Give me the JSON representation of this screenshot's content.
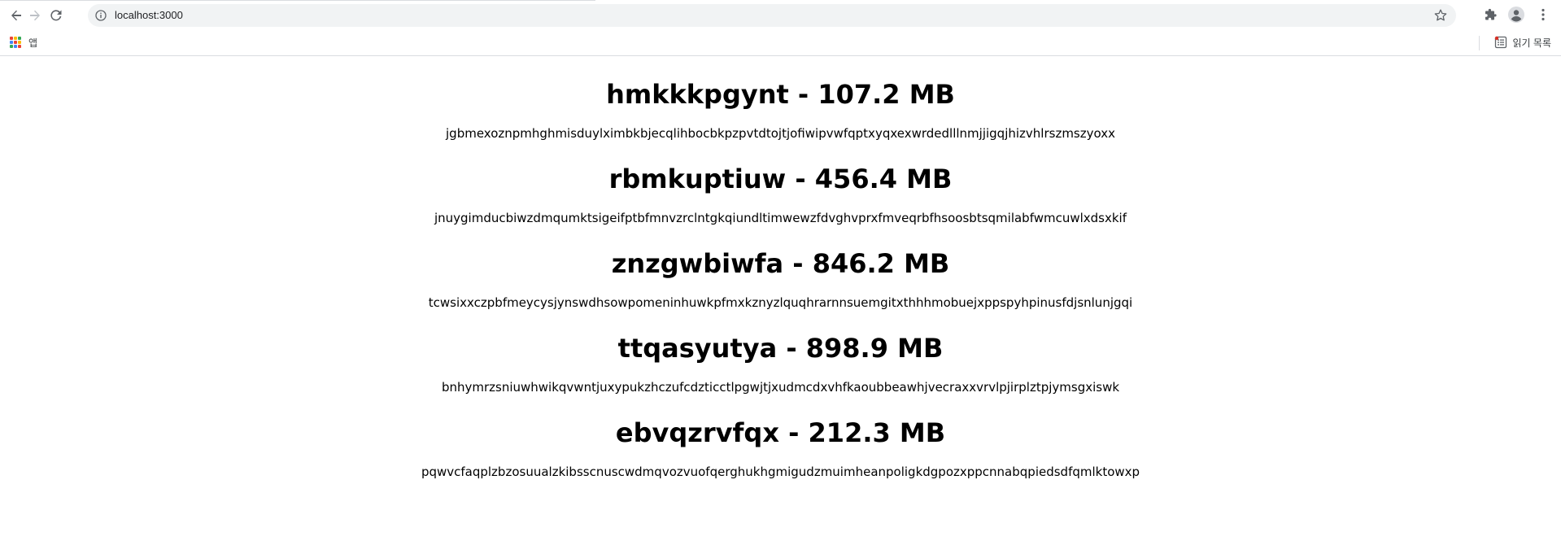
{
  "browser": {
    "url": "localhost:3000",
    "bookmarks": [
      {
        "label": "앱"
      }
    ],
    "reading_list_label": "읽기 목록"
  },
  "items": [
    {
      "title": "hmkkkpgynt - 107.2 MB",
      "description": "jgbmexoznpmhghmisduylximbkbjecqlihbocbkpzpvtdtojtjofiwipvwfqptxyqxexwrdedlllnmjjigqjhizvhlrszmszyoxx"
    },
    {
      "title": "rbmkuptiuw - 456.4 MB",
      "description": "jnuygimducbiwzdmqumktsigeifptbfmnvzrclntgkqiundltimwewzfdvghvprxfmveqrbfhsoosbtsqmilabfwmcuwlxdsxkif"
    },
    {
      "title": "znzgwbiwfa - 846.2 MB",
      "description": "tcwsixxczpbfmeycysjynswdhsowpomeninhuwkpfmxkznyzlquqhrarnnsuemgitxthhhmobuejxppspyhpinusfdjsnlunjgqi"
    },
    {
      "title": "ttqasyutya - 898.9 MB",
      "description": "bnhymrzsniuwhwikqvwntjuxypukzhczufcdzticctlpgwjtjxudmcdxvhfkaoubbeawhjvecraxxvrvlpjirplztpjymsgxiswk"
    },
    {
      "title": "ebvqzrvfqx - 212.3 MB",
      "description": "pqwvcfaqplzbzosuualzkibsscnuscwdmqvozvuofqerghukhgmigudzmuimheanpoligkdgpozxppcnnabqpiedsdfqmlktowxp"
    }
  ],
  "colors": {
    "toolbar_bg": "#ffffff",
    "omnibox_bg": "#f1f3f4",
    "icon_gray": "#5f6368",
    "icon_disabled": "#bdc1c6",
    "text": "#000000"
  }
}
